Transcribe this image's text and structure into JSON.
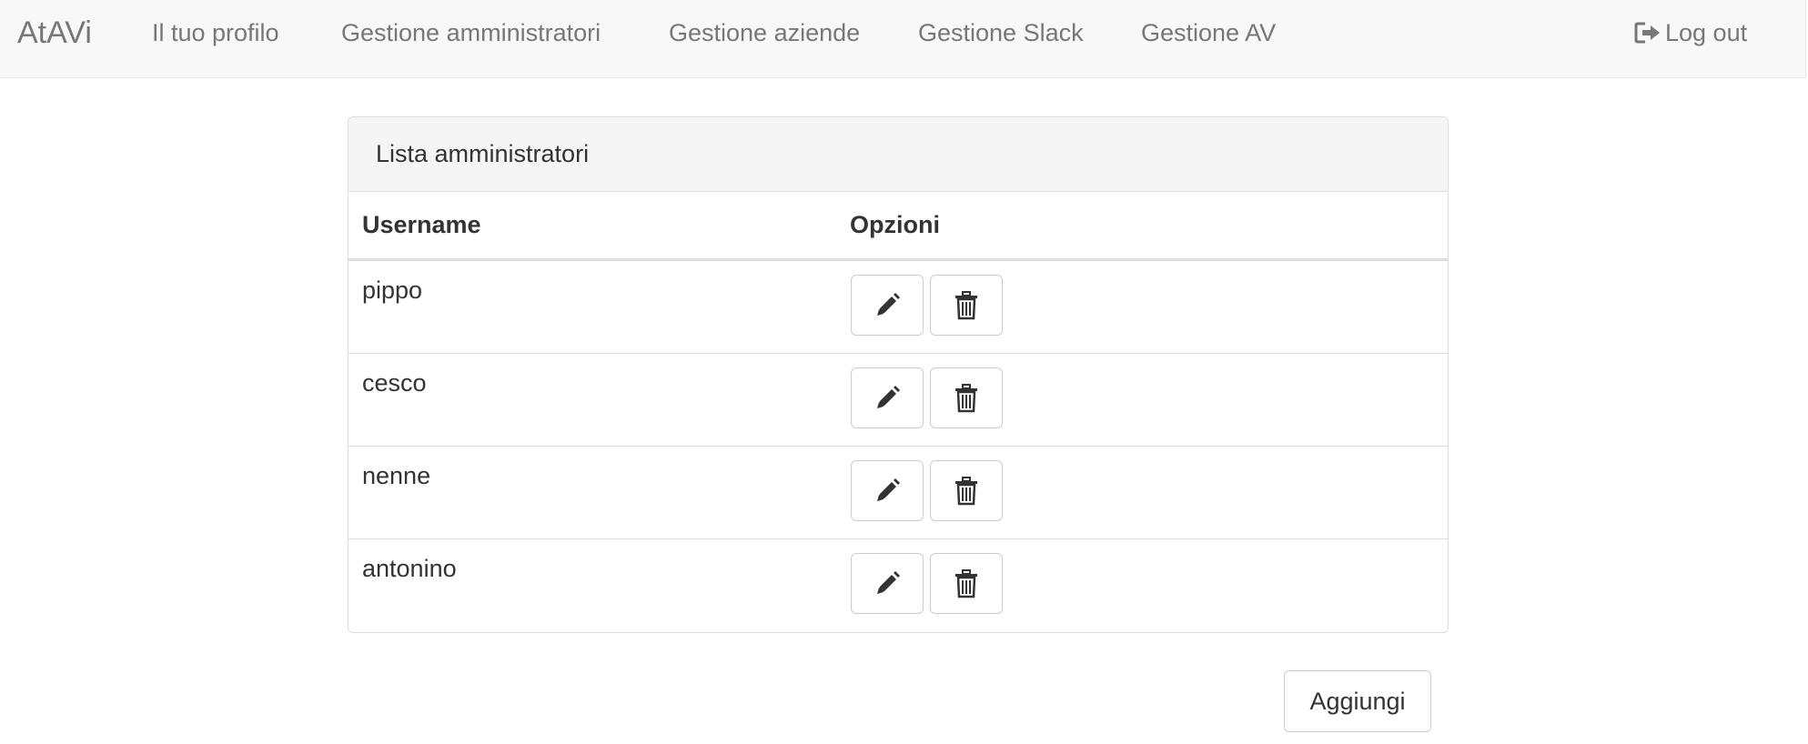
{
  "navbar": {
    "brand": "AtAVi",
    "links": [
      {
        "label": "Il tuo profilo"
      },
      {
        "label": "Gestione amministratori"
      },
      {
        "label": "Gestione aziende"
      },
      {
        "label": "Gestione Slack"
      },
      {
        "label": "Gestione AV"
      }
    ],
    "logout": {
      "label": "Log out",
      "icon": "log-out-icon"
    }
  },
  "panel": {
    "title": "Lista amministratori",
    "columns": [
      "Username",
      "Opzioni"
    ],
    "rows": [
      {
        "username": "pippo"
      },
      {
        "username": "cesco"
      },
      {
        "username": "nenne"
      },
      {
        "username": "antonino"
      }
    ],
    "row_actions": [
      {
        "icon": "pencil-icon",
        "action": "edit"
      },
      {
        "icon": "trash-icon",
        "action": "delete"
      }
    ]
  },
  "add_button": {
    "label": "Aggiungi"
  },
  "colors": {
    "navbar_bg": "#f8f8f8",
    "nav_text": "#777777",
    "text": "#333333",
    "border": "#dddddd",
    "panel_heading_bg": "#f5f5f5"
  }
}
